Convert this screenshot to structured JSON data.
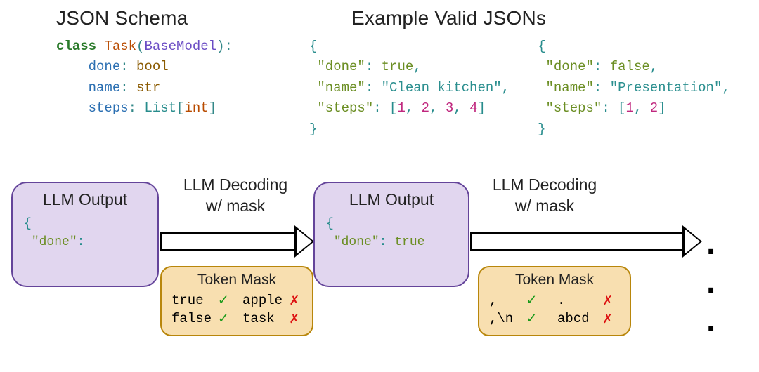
{
  "schema": {
    "heading": "JSON Schema",
    "line1_kw": "class",
    "line1_cls": "Task",
    "line1_base": "BaseModel",
    "attr1": "done",
    "type1": "bool",
    "attr2": "name",
    "type2": "str",
    "attr3": "steps",
    "type3_list": "List",
    "type3_inner": "int"
  },
  "examples": {
    "heading": "Example Valid JSONs",
    "ex1": {
      "done_key": "\"done\"",
      "done_val": "true",
      "name_key": "\"name\"",
      "name_val": "\"Clean kitchen\"",
      "steps_key": "\"steps\"",
      "steps_vals": [
        "1",
        "2",
        "3",
        "4"
      ]
    },
    "ex2": {
      "done_key": "\"done\"",
      "done_val": "false",
      "name_key": "\"name\"",
      "name_val": "\"Presentation\"",
      "steps_key": "\"steps\"",
      "steps_vals": [
        "1",
        "2"
      ]
    }
  },
  "flow": {
    "box1_title": "LLM Output",
    "box1_code_key": "\"done\"",
    "box1_code_tail": ":",
    "box2_title": "LLM Output",
    "box2_code_key": "\"done\"",
    "box2_code_val": "true",
    "arrow_label1_line1": "LLM Decoding",
    "arrow_label1_line2": "w/ mask",
    "arrow_label2_line1": "LLM Decoding",
    "arrow_label2_line2": "w/ mask",
    "mask1": {
      "title": "Token Mask",
      "rows": [
        {
          "good": "true",
          "bad": "apple"
        },
        {
          "good": "false",
          "bad": "task"
        }
      ]
    },
    "mask2": {
      "title": "Token Mask",
      "rows": [
        {
          "good": ",",
          "bad": "."
        },
        {
          "good": ",\\n",
          "bad": "abcd"
        }
      ]
    },
    "ellipsis": ". . ."
  }
}
